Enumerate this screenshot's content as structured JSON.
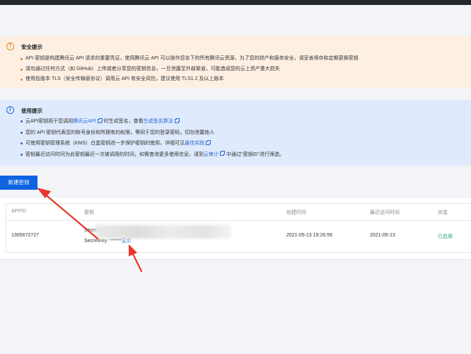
{
  "security_notice": {
    "title": "安全提示",
    "items": [
      "API 密钥是构建腾讯云 API 请求的重要凭证，使用腾讯云 API 可以操作您名下的所有腾讯云资源，为了您的财产和服务安全，请妥善保存和定期更换密钥",
      "请勿通过任何方式（如 GitHub）上传或者分享您的密钥信息，一旦泄露至外部渠道，可能造成您的云上资产重大损失",
      "使用低版本 TLS（安全传输层协议）调用云 API 有安全风险，建议使用 TLS1.2 及以上版本"
    ]
  },
  "usage_notice": {
    "title": "使用提示",
    "item1_pre": "云API密钥用于您调用",
    "item1_link1": "腾讯云API",
    "item1_mid": "时生成签名，查看",
    "item1_link2": "生成签名算法",
    "item2": "您的 API 密钥代表您的账号身份和所拥有的权限，等同于您的登录密码，切勿泄露他人",
    "item3_pre": "可使用密钥管理系统（KMS）白盒密钥进一步保护密钥的使用，详细可见",
    "item3_link": "最佳实践",
    "item4_pre": "密钥最近访问时间为此密钥最近一次被调用的时间，如需查询更多使用信息，请到",
    "item4_link": "云审计",
    "item4_post": "中通过\"密钥ID\"进行筛选。"
  },
  "toolbar": {
    "new_key_label": "新建密钥"
  },
  "table": {
    "headers": {
      "appid": "APPID",
      "key": "密钥",
      "created": "创建时间",
      "last_access": "最近访问时间",
      "status": "状态"
    },
    "rows": [
      {
        "appid": "1305672727",
        "secret_id_prefix": "Secre",
        "secret_key_prefix": "SecretKey: ******",
        "show_label": "显示",
        "created": "2021-05-13 19:26:56",
        "last_access": "2021-05-13",
        "status": "已启用"
      }
    ]
  },
  "colors": {
    "primary": "#0d63e0",
    "warn_bg": "#fdf0e3",
    "info_bg": "#dfeafc",
    "status_ok": "#29a36a",
    "annotation": "#e8362a"
  }
}
